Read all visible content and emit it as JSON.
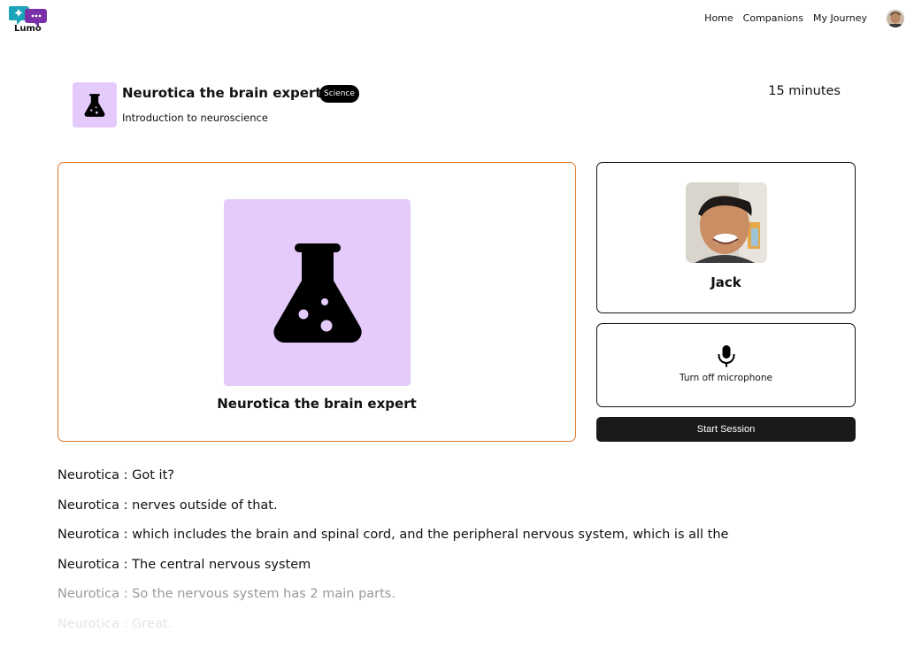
{
  "nav": {
    "brand": "Lumo",
    "links": [
      "Home",
      "Companions",
      "My Journey"
    ]
  },
  "header": {
    "title": "Neurotica the brain expert",
    "badge": "Science",
    "subtitle": "Introduction to neuroscience",
    "duration": "15 minutes"
  },
  "companion": {
    "name": "Neurotica the brain expert",
    "icon": "flask-icon",
    "bg_color": "#e4cbfb",
    "border_color": "#e07a2e"
  },
  "user": {
    "name": "Jack"
  },
  "controls": {
    "mic_label": "Turn off microphone",
    "start_label": "Start Session"
  },
  "transcript": [
    {
      "speaker": "Neurotica",
      "text": "Got it?"
    },
    {
      "speaker": "Neurotica",
      "text": "nerves outside of that."
    },
    {
      "speaker": "Neurotica",
      "text": "which includes the brain and spinal cord, and the peripheral nervous system, which is all the"
    },
    {
      "speaker": "Neurotica",
      "text": "The central nervous system"
    },
    {
      "speaker": "Neurotica",
      "text": "So the nervous system has 2 main parts."
    },
    {
      "speaker": "Neurotica",
      "text": "Great."
    }
  ]
}
